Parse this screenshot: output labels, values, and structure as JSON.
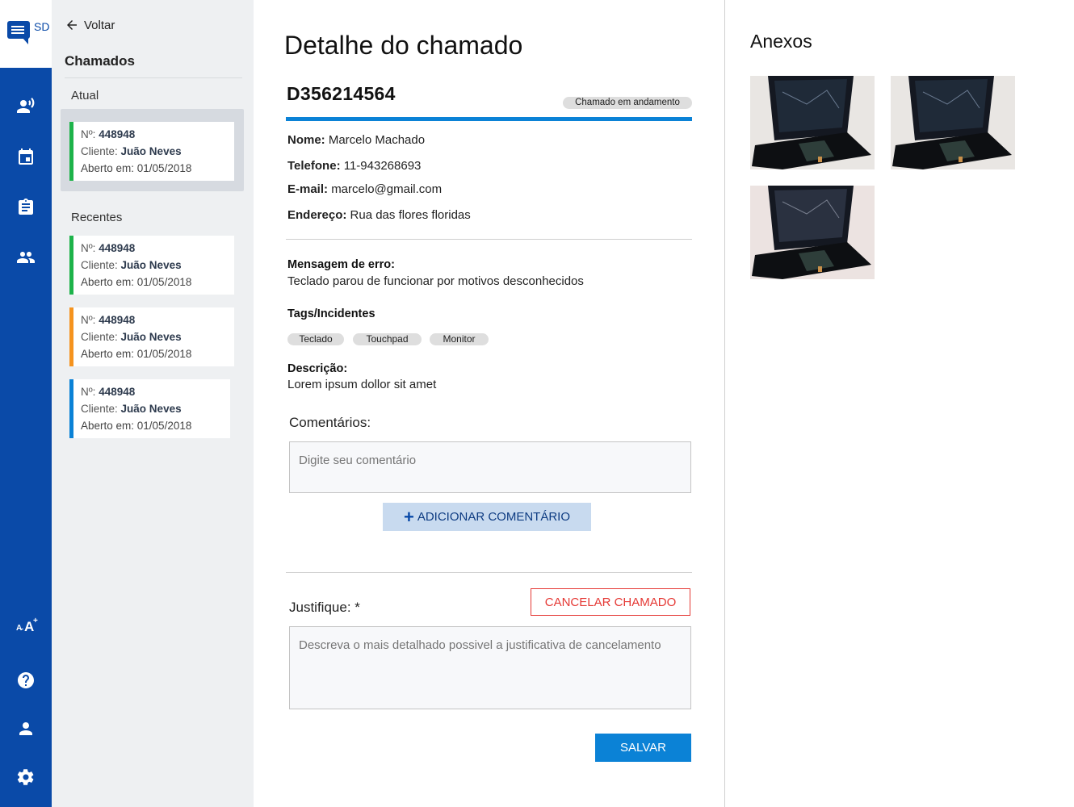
{
  "app": {
    "logo_letters": "SD",
    "accent_color": "#0a4aa8",
    "rail_icons": [
      "speaker-icon",
      "calendar-icon",
      "clipboard-icon",
      "people-icon",
      "font-size-icon",
      "help-icon",
      "person-icon",
      "gear-icon"
    ]
  },
  "list": {
    "back_label": "Voltar",
    "title": "Chamados",
    "current_label": "Atual",
    "recent_label": "Recentes",
    "current": {
      "number_label": "Nº:",
      "number": "448948",
      "client_label": "Cliente:",
      "client": "Juão Neves",
      "opened": "Aberto em: 01/05/2018",
      "color": "#1db34a"
    },
    "recent": [
      {
        "number_label": "Nº:",
        "number": "448948",
        "client_label": "Cliente:",
        "client": "Juão Neves",
        "opened": "Aberto em: 01/05/2018",
        "color": "#1db34a"
      },
      {
        "number_label": "Nº:",
        "number": "448948",
        "client_label": "Cliente:",
        "client": "Juão Neves",
        "opened": "Aberto em: 01/05/2018",
        "color": "#f5931e"
      },
      {
        "number_label": "Nº:",
        "number": "448948",
        "client_label": "Cliente:",
        "client": "Juão Neves",
        "opened": "Aberto em: 01/05/2018",
        "color": "#0b82d6"
      }
    ]
  },
  "detail": {
    "page_title": "Detalhe do chamado",
    "ticket_id": "D356214564",
    "status": "Chamado em andamento",
    "name_label": "Nome:",
    "name": "Marcelo Machado",
    "phone_label": "Telefone:",
    "phone": "11-943268693",
    "email_label": "E-mail:",
    "email": "marcelo@gmail.com",
    "address_label": "Endereço:",
    "address": "Rua das flores floridas",
    "error_label": "Mensagem de erro:",
    "error_text": "Teclado parou de funcionar por motivos desconhecidos",
    "tags_label": "Tags/Incidentes",
    "tags": [
      "Teclado",
      "Touchpad",
      "Monitor"
    ],
    "description_label": "Descrição:",
    "description": "Lorem ipsum dollor sit amet",
    "comments_label": "Comentários:",
    "comment_placeholder": "Digite seu comentário",
    "add_comment_label": "ADICIONAR COMENTÁRIO",
    "justify_label": "Justifique: *",
    "cancel_label": "CANCELAR CHAMADO",
    "justify_placeholder": "Descreva o mais detalhado possivel a justificativa de cancelamento",
    "save_label": "SALVAR"
  },
  "attachments": {
    "title": "Anexos",
    "images": [
      "laptop-photo",
      "laptop-photo",
      "laptop-photo"
    ]
  }
}
